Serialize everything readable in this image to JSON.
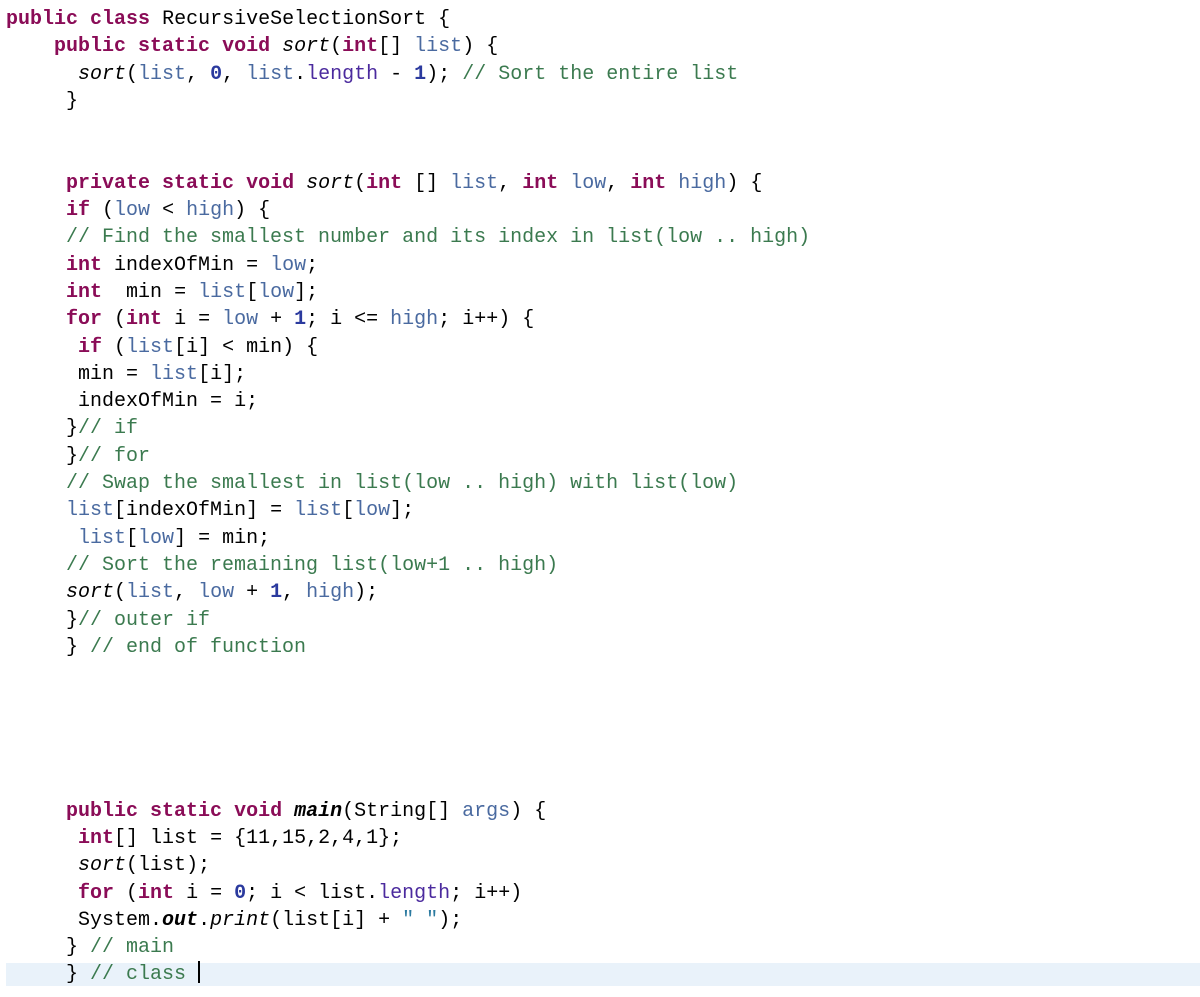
{
  "code": {
    "className": "RecursiveSelectionSort",
    "l2_param": "list",
    "l3_list": "list",
    "l3_len": "length",
    "l3_n0": "0",
    "l3_n1": "1",
    "l3_c": "// Sort the entire list",
    "l7_list": "list",
    "l7_low": "low",
    "l7_high": "high",
    "l8_low": "low",
    "l8_high": "high",
    "l9_c": "// Find the smallest number and its index in list(low .. high)",
    "l10_v": "indexOfMin",
    "l10_r": "low",
    "l11_v": "min",
    "l11_arr": "list",
    "l11_idx": "low",
    "l12_i": "i",
    "l12_low": "low",
    "l12_n1": "1",
    "l12_hi": "high",
    "l12_inc": "i++",
    "l13_arr": "list",
    "l13_i": "i",
    "l13_min": "min",
    "l14_min": "min",
    "l14_arr": "list",
    "l14_i": "i",
    "l15_v": "indexOfMin",
    "l15_i": "i",
    "l16_c": "// if",
    "l17_c": "// for",
    "l18_c": "// Swap the smallest in list(low .. high) with list(low)",
    "l19_a": "list",
    "l19_ai": "indexOfMin",
    "l19_b": "list",
    "l19_bi": "low",
    "l20_a": "list",
    "l20_ai": "low",
    "l20_b": "min",
    "l21_c": "// Sort the remaining list(low+1 .. high)",
    "l22_list": "list",
    "l22_low": "low",
    "l22_n1": "1",
    "l22_hi": "high",
    "l23_c": "// outer if",
    "l24_c": "// end of function",
    "l30_args": "args",
    "l31_list": "list",
    "l31_vals": "{11,15,2,4,1}",
    "l32_list": "list",
    "l33_i": "i",
    "l33_n0": "0",
    "l33_list": "list",
    "l33_len": "length",
    "l33_inc": "i++",
    "l34_out": "out",
    "l34_arr": "list",
    "l34_i": "i",
    "l34_str": "\" \"",
    "l35_c": "// main",
    "l36_c": "// class "
  },
  "kw": {
    "public": "public",
    "class": "class",
    "static": "static",
    "void": "void",
    "int": "int",
    "private": "private",
    "if": "if",
    "for": "for"
  },
  "fn": {
    "sort": "sort",
    "main": "main",
    "print": "print"
  },
  "sym": {
    "Int": "int",
    "String": "String",
    "System": "System"
  }
}
